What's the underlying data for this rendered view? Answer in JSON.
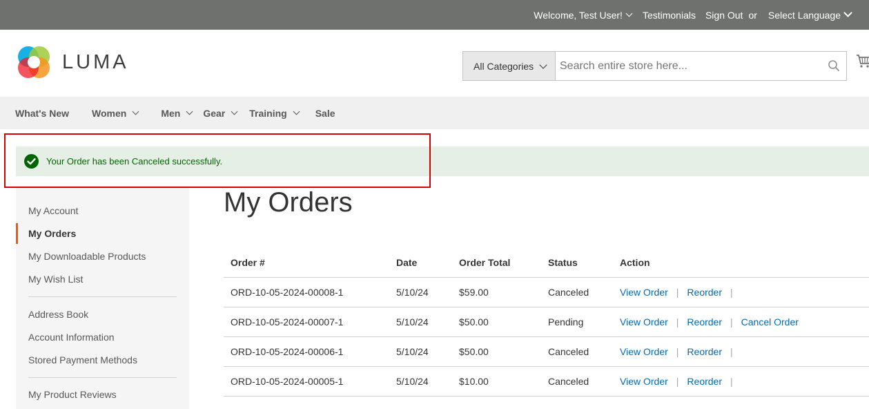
{
  "topbar": {
    "welcome": "Welcome, Test User!",
    "testimonials": "Testimonials",
    "sign_out": "Sign Out",
    "or": "or",
    "language": "Select Language"
  },
  "header": {
    "logo_text": "LUMA",
    "category_select": "All Categories",
    "search_placeholder": "Search entire store here..."
  },
  "nav": {
    "items": [
      {
        "label": "What's New"
      },
      {
        "label": "Women"
      },
      {
        "label": "Men"
      },
      {
        "label": "Gear"
      },
      {
        "label": "Training"
      },
      {
        "label": "Sale"
      }
    ]
  },
  "message": {
    "text": "Your Order has been Canceled successfully.",
    "highlight_color": "#d40000"
  },
  "sidebar": {
    "items": [
      {
        "label": "My Account"
      },
      {
        "label": "My Orders"
      },
      {
        "label": "My Downloadable Products"
      },
      {
        "label": "My Wish List"
      },
      {
        "label": "Address Book"
      },
      {
        "label": "Account Information"
      },
      {
        "label": "Stored Payment Methods"
      },
      {
        "label": "My Product Reviews"
      }
    ],
    "active_accent": "#ff5501"
  },
  "main": {
    "title": "My Orders",
    "columns": [
      "Order #",
      "Date",
      "Order Total",
      "Status",
      "Action"
    ],
    "actions": {
      "view": "View Order",
      "reorder": "Reorder",
      "cancel": "Cancel Order"
    },
    "rows": [
      {
        "order": "ORD-10-05-2024-00008-1",
        "date": "5/10/24",
        "total": "$59.00",
        "status": "Canceled"
      },
      {
        "order": "ORD-10-05-2024-00007-1",
        "date": "5/10/24",
        "total": "$50.00",
        "status": "Pending"
      },
      {
        "order": "ORD-10-05-2024-00006-1",
        "date": "5/10/24",
        "total": "$50.00",
        "status": "Canceled"
      },
      {
        "order": "ORD-10-05-2024-00005-1",
        "date": "5/10/24",
        "total": "$10.00",
        "status": "Canceled"
      }
    ]
  },
  "colors": {
    "topbar_bg": "#6e716e",
    "nav_bg": "#f0f0f0",
    "success_bg": "#e5efe5",
    "success_text": "#006400",
    "link": "#006bb4"
  }
}
